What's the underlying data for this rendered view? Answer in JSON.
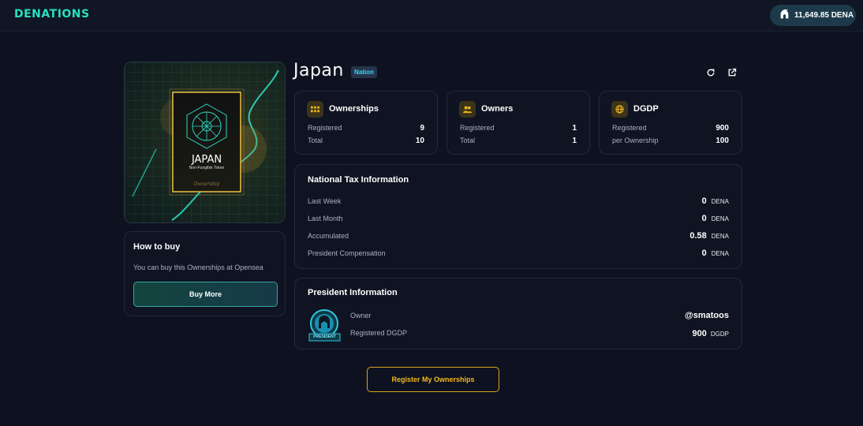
{
  "header": {
    "logo": "DENATIONS",
    "wallet_balance": "11,649.85 DENA"
  },
  "nft": {
    "card_title": "JAPAN",
    "card_subtitle": "Non-Fungible Token",
    "card_footer": "Ownership"
  },
  "how_to_buy": {
    "title": "How to buy",
    "text": "You can buy this Ownerships at Opensea",
    "button": "Buy More"
  },
  "nation": {
    "name": "Japan",
    "badge": "Nation"
  },
  "stats": [
    {
      "title": "Ownerships",
      "icon": "grid-icon",
      "rows": [
        {
          "label": "Registered",
          "value": "9"
        },
        {
          "label": "Total",
          "value": "10"
        }
      ]
    },
    {
      "title": "Owners",
      "icon": "users-icon",
      "rows": [
        {
          "label": "Registered",
          "value": "1"
        },
        {
          "label": "Total",
          "value": "1"
        }
      ]
    },
    {
      "title": "DGDP",
      "icon": "globe-icon",
      "rows": [
        {
          "label": "Registered",
          "value": "900"
        },
        {
          "label": "per Ownership",
          "value": "100"
        }
      ]
    }
  ],
  "tax": {
    "title": "National Tax Information",
    "unit": "DENA",
    "rows": [
      {
        "label": "Last Week",
        "value": "0"
      },
      {
        "label": "Last Month",
        "value": "0"
      },
      {
        "label": "Accumulated",
        "value": "0.58"
      },
      {
        "label": "President Compensation",
        "value": "0"
      }
    ]
  },
  "president": {
    "title": "President Information",
    "badge_text": "PRESIDENT",
    "owner_label": "Owner",
    "owner_value": "@smatoos",
    "dgdp_label": "Registered DGDP",
    "dgdp_value": "900",
    "dgdp_unit": "DGDP"
  },
  "register_button": "Register My Ownerships",
  "colors": {
    "accent_teal": "#29e0c0",
    "accent_gold": "#f2b820",
    "background": "#0e1220"
  }
}
